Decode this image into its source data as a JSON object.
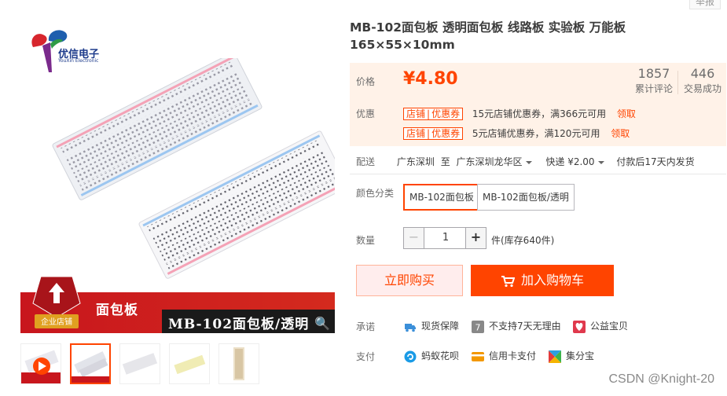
{
  "report_label": "举报",
  "brand": {
    "name": "优信电子",
    "sub": "YouXin Electronic"
  },
  "banner": {
    "badge": "企业店铺",
    "line1": "面包板",
    "line2": "MB-102面包板/透明"
  },
  "product": {
    "title_line1": "MB-102面包板 透明面包板 线路板 实验板 万能板",
    "title_line2": "165×55×10mm"
  },
  "price": {
    "label": "价格",
    "value": "¥4.80",
    "reviews_count": "1857",
    "reviews_label": "累计评论",
    "sales_count": "446",
    "sales_label": "交易成功"
  },
  "coupons": {
    "label": "优惠",
    "items": [
      {
        "tag_a": "店铺",
        "tag_b": "优惠券",
        "text": "15元店铺优惠券，满366元可用",
        "action": "领取"
      },
      {
        "tag_a": "店铺",
        "tag_b": "优惠券",
        "text": "5元店铺优惠券，满120元可用",
        "action": "领取"
      }
    ]
  },
  "shipping": {
    "label": "配送",
    "from": "广东深圳",
    "to_word": "至",
    "to": "广东深圳龙华区",
    "method": "快递 ¥2.00",
    "note": "付款后17天内发货"
  },
  "color": {
    "label": "颜色分类",
    "options": [
      "MB-102面包板",
      "MB-102面包板/透明"
    ]
  },
  "quantity": {
    "label": "数量",
    "minus": "−",
    "value": "1",
    "plus": "+",
    "stock": "件(库存640件)"
  },
  "actions": {
    "buy_now": "立即购买",
    "add_cart": "加入购物车"
  },
  "services": {
    "label": "承诺",
    "items": [
      "现货保障",
      "不支持7天无理由",
      "公益宝贝"
    ]
  },
  "payment": {
    "label": "支付",
    "items": [
      "蚂蚁花呗",
      "信用卡支付",
      "集分宝"
    ]
  },
  "watermark": "CSDN @Knight-20",
  "colors": {
    "accent": "#ff4400",
    "price_bg": "#fff2e8",
    "banner_red": "#c8161d"
  }
}
